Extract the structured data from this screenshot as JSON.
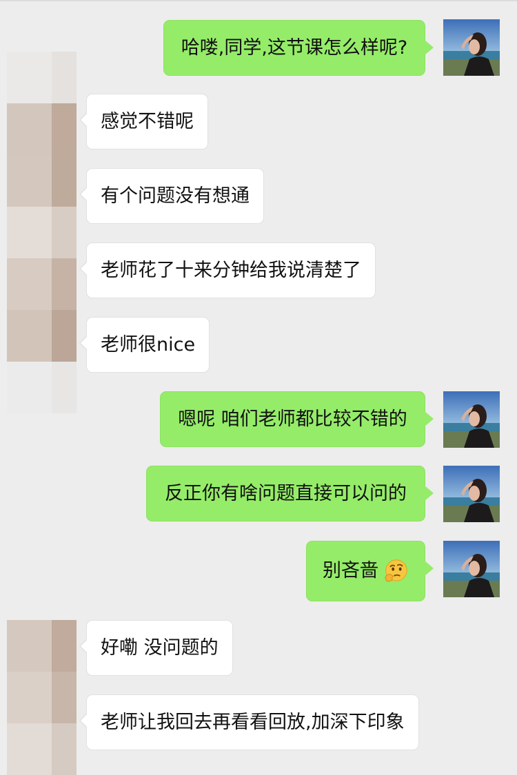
{
  "chat": {
    "messages": [
      {
        "side": "right",
        "text": "哈喽,同学,这节课怎么样呢?"
      },
      {
        "side": "left",
        "text": "感觉不错呢"
      },
      {
        "side": "left",
        "text": "有个问题没有想通"
      },
      {
        "side": "left",
        "text": "老师花了十来分钟给我说清楚了"
      },
      {
        "side": "left",
        "text": "老师很nice"
      },
      {
        "side": "right",
        "text": "嗯呢 咱们老师都比较不错的"
      },
      {
        "side": "right",
        "text": "反正你有啥问题直接可以问的"
      },
      {
        "side": "right",
        "text": "别吝啬",
        "emoji": "thinking-face-emoji"
      },
      {
        "side": "left",
        "text": "好嘞 没问题的"
      },
      {
        "side": "left",
        "text": "老师让我回去再看看回放,加深下印象"
      }
    ]
  },
  "colors": {
    "background": "#ededed",
    "sent_bubble": "#95ec69",
    "received_bubble": "#ffffff"
  },
  "icons": {
    "sender_avatar": "profile-photo-avatar",
    "receiver_avatar": "pixelated-avatar",
    "emoji": "thinking-face-emoji"
  }
}
